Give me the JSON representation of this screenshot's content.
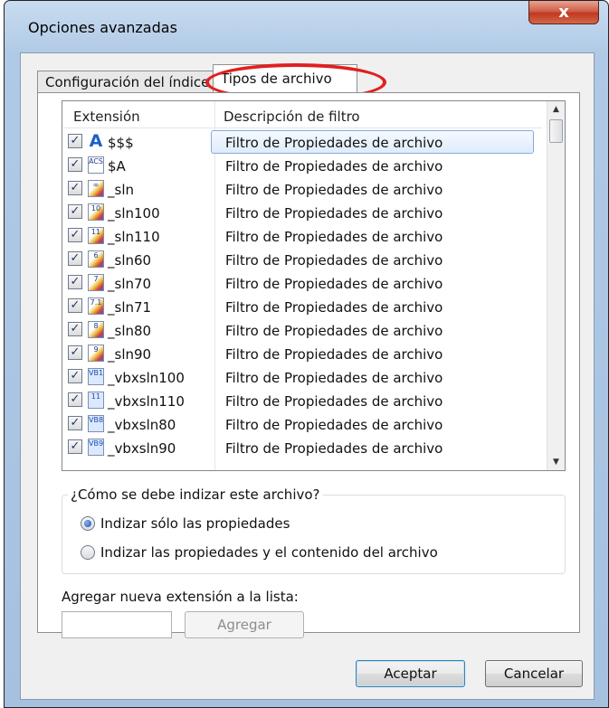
{
  "window": {
    "title": "Opciones avanzadas",
    "close_glyph": "x"
  },
  "tabs": [
    {
      "label": "Configuración del índice",
      "active": false
    },
    {
      "label": "Tipos de archivo",
      "active": true
    }
  ],
  "list": {
    "columns": [
      "Extensión",
      "Descripción de filtro"
    ],
    "rows": [
      {
        "ext": "$$$",
        "desc": "Filtro de Propiedades de archivo",
        "checked": true,
        "icon": "font-file-icon"
      },
      {
        "ext": "$A",
        "desc": "Filtro de Propiedades de archivo",
        "checked": true,
        "icon": "acs-file-icon"
      },
      {
        "ext": "_sln",
        "desc": "Filtro de Propiedades de archivo",
        "checked": true,
        "icon": "vs-solution-icon"
      },
      {
        "ext": "_sln100",
        "desc": "Filtro de Propiedades de archivo",
        "checked": true,
        "icon": "vs-solution-10-icon"
      },
      {
        "ext": "_sln110",
        "desc": "Filtro de Propiedades de archivo",
        "checked": true,
        "icon": "vs-solution-11-icon"
      },
      {
        "ext": "_sln60",
        "desc": "Filtro de Propiedades de archivo",
        "checked": true,
        "icon": "vs-solution-6-icon"
      },
      {
        "ext": "_sln70",
        "desc": "Filtro de Propiedades de archivo",
        "checked": true,
        "icon": "vs-solution-7-icon"
      },
      {
        "ext": "_sln71",
        "desc": "Filtro de Propiedades de archivo",
        "checked": true,
        "icon": "vs-solution-71-icon"
      },
      {
        "ext": "_sln80",
        "desc": "Filtro de Propiedades de archivo",
        "checked": true,
        "icon": "vs-solution-8-icon"
      },
      {
        "ext": "_sln90",
        "desc": "Filtro de Propiedades de archivo",
        "checked": true,
        "icon": "vs-solution-9-icon"
      },
      {
        "ext": "_vbxsln100",
        "desc": "Filtro de Propiedades de archivo",
        "checked": true,
        "icon": "vb-solution-10-icon"
      },
      {
        "ext": "_vbxsln110",
        "desc": "Filtro de Propiedades de archivo",
        "checked": true,
        "icon": "vb-solution-11-icon"
      },
      {
        "ext": "_vbxsln80",
        "desc": "Filtro de Propiedades de archivo",
        "checked": true,
        "icon": "vb-solution-8-icon"
      },
      {
        "ext": "_vbxsln90",
        "desc": "Filtro de Propiedades de archivo",
        "checked": true,
        "icon": "vb-solution-9-icon"
      }
    ],
    "selected_index": 0
  },
  "index_group": {
    "title": "¿Cómo se debe indizar este archivo?",
    "options": [
      {
        "label": "Indizar sólo las propiedades",
        "selected": true
      },
      {
        "label": "Indizar las propiedades y el contenido del archivo",
        "selected": false
      }
    ]
  },
  "add_extension": {
    "label": "Agregar nueva extensión a la lista:",
    "value": "",
    "button_label": "Agregar"
  },
  "footer": {
    "ok_label": "Aceptar",
    "cancel_label": "Cancelar"
  },
  "colors": {
    "title_bar": "#b9d1ea",
    "close_button": "#c0391f",
    "highlight_ellipse": "#e02020",
    "selection": "#dfecfb"
  }
}
